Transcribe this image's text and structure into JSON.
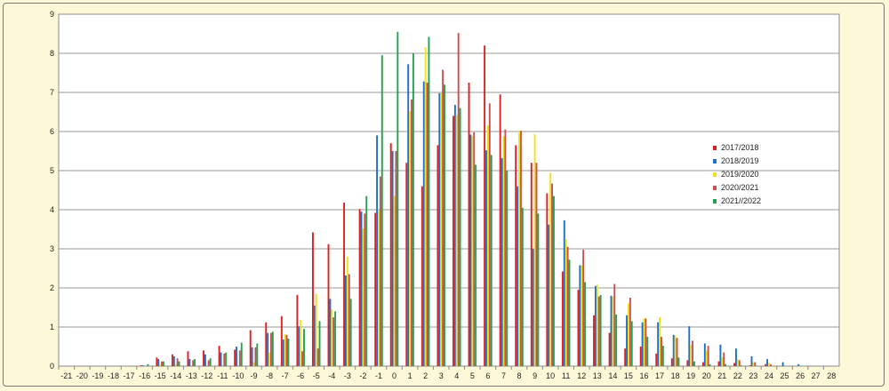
{
  "chart_data": {
    "type": "bar",
    "title": "",
    "xlabel": "",
    "ylabel": "",
    "categories": [
      -21,
      -20,
      -19,
      -18,
      -17,
      -16,
      -15,
      -14,
      -13,
      -12,
      -11,
      -10,
      -9,
      -8,
      -7,
      -6,
      -5,
      -4,
      -3,
      -2,
      -1,
      0,
      1,
      2,
      3,
      4,
      5,
      6,
      7,
      8,
      9,
      10,
      11,
      12,
      13,
      14,
      15,
      16,
      17,
      18,
      19,
      20,
      21,
      22,
      23,
      24,
      25,
      26,
      27,
      28
    ],
    "ylim": [
      0,
      9
    ],
    "yticks": [
      0,
      1,
      2,
      3,
      4,
      5,
      6,
      7,
      8,
      9
    ],
    "grid": true,
    "legend_position": "right",
    "series": [
      {
        "name": "2017/2018",
        "color": "#e02020",
        "values": [
          0,
          0,
          0,
          0,
          0,
          0.02,
          0.22,
          0.3,
          0.38,
          0.4,
          0.52,
          0.42,
          0.92,
          1.12,
          1.28,
          1.82,
          3.42,
          3.12,
          4.18,
          4.02,
          3.92,
          5.7,
          5.2,
          4.6,
          5.65,
          6.4,
          7.25,
          8.2,
          6.95,
          5.65,
          5.2,
          4.42,
          2.42,
          1.95,
          1.3,
          0.85,
          0.45,
          0.5,
          0.32,
          0.2,
          0.15,
          0.1,
          0.12,
          0.08,
          0.02,
          0.05,
          0,
          0,
          0,
          0
        ]
      },
      {
        "name": "2018/2019",
        "color": "#1f6fc8",
        "values": [
          0,
          0,
          0,
          0,
          0,
          0.02,
          0.18,
          0.25,
          0.18,
          0.3,
          0.35,
          0.5,
          0.48,
          0.85,
          0.68,
          1.02,
          1.55,
          1.72,
          2.32,
          3.95,
          5.9,
          5.5,
          7.72,
          7.28,
          6.98,
          6.68,
          5.92,
          5.52,
          5.32,
          4.6,
          3.0,
          3.62,
          3.73,
          2.58,
          2.05,
          1.8,
          1.3,
          1.12,
          1.12,
          0.8,
          1.02,
          0.58,
          0.55,
          0.45,
          0.25,
          0.18,
          0.1,
          0.05,
          0,
          0
        ]
      },
      {
        "name": "2019/2020",
        "color": "#f0e020",
        "values": [
          0,
          0,
          0,
          0,
          0,
          0,
          0.05,
          0.05,
          0,
          0,
          0,
          0,
          0.1,
          0.35,
          0.82,
          1.18,
          1.85,
          1.45,
          2.8,
          3.52,
          4.0,
          4.35,
          6.52,
          8.15,
          6.98,
          6.42,
          5.88,
          6.15,
          5.88,
          6.02,
          5.93,
          4.95,
          3.25,
          2.58,
          2.08,
          1.78,
          1.6,
          1.22,
          1.25,
          0.78,
          0.55,
          0.4,
          0.22,
          0.18,
          0.1,
          0.08,
          0,
          0,
          0,
          0
        ]
      },
      {
        "name": "2020/2021",
        "color": "#c95050",
        "values": [
          0,
          0,
          0,
          0,
          0,
          0,
          0.12,
          0.2,
          0.15,
          0.15,
          0.32,
          0.4,
          0.48,
          0.85,
          0.8,
          0.38,
          0.45,
          1.25,
          2.35,
          3.9,
          4.85,
          5.5,
          6.82,
          7.25,
          7.58,
          8.52,
          5.98,
          6.72,
          6.05,
          6.02,
          5.2,
          4.67,
          3.05,
          2.98,
          1.78,
          2.1,
          1.75,
          1.22,
          0.75,
          0.72,
          0.65,
          0.52,
          0.35,
          0.15,
          0.1,
          0.05,
          0,
          0,
          0,
          0
        ]
      },
      {
        "name": "2021//2022",
        "color": "#28a050",
        "values": [
          0,
          0,
          0,
          0,
          0,
          0.05,
          0.12,
          0.12,
          0.18,
          0.2,
          0.35,
          0.6,
          0.58,
          0.88,
          0.7,
          0.95,
          1.15,
          1.4,
          1.72,
          4.35,
          7.95,
          8.55,
          8.0,
          8.42,
          7.2,
          6.6,
          5.15,
          5.4,
          5.0,
          4.05,
          3.9,
          4.35,
          2.72,
          2.15,
          1.82,
          1.32,
          1.15,
          0.75,
          0.52,
          0.22,
          0.12,
          0.05,
          0.05,
          0.02,
          0,
          0,
          0,
          0,
          0,
          0
        ]
      }
    ]
  }
}
